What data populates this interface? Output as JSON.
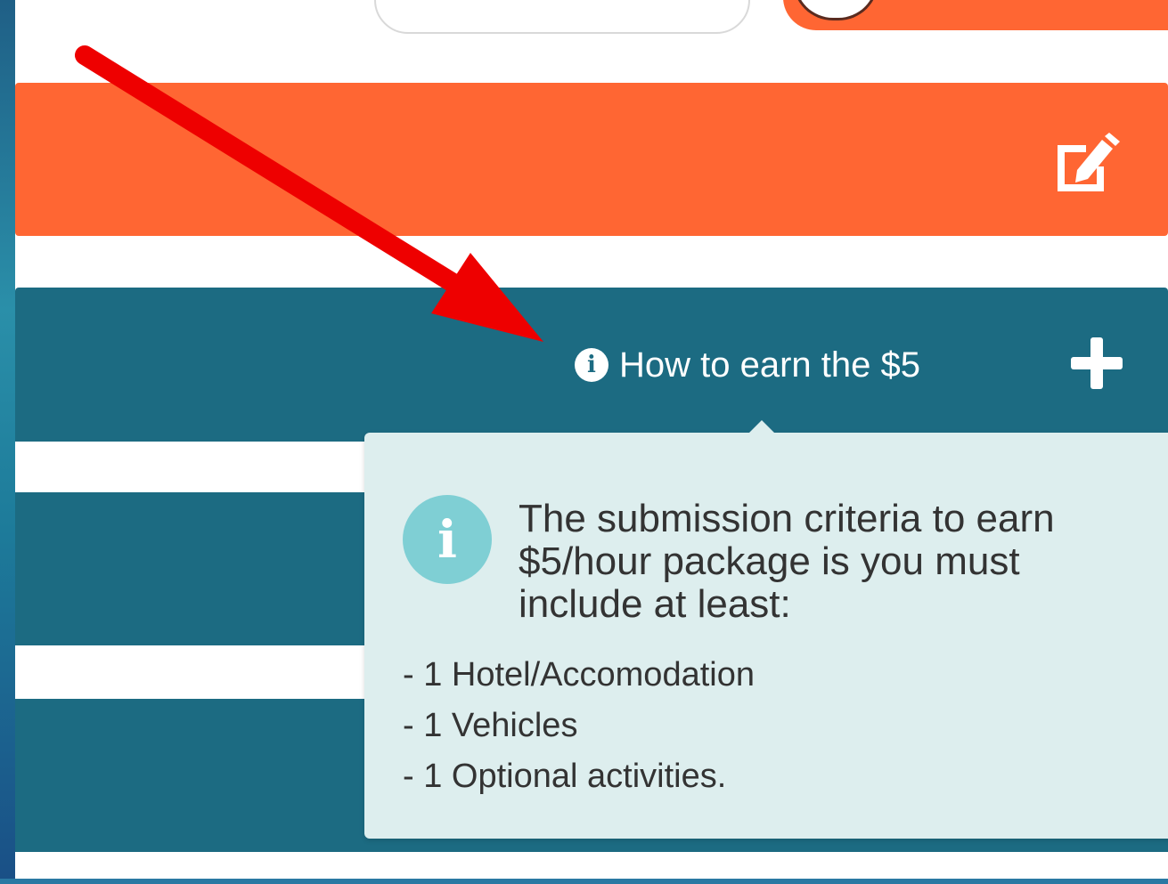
{
  "colors": {
    "orange": "#ff6633",
    "teal": "#1c6b82",
    "popover_bg": "#ddeeee",
    "info_circle": "#7fcfd4",
    "annotation_red": "#ee0000"
  },
  "orange_bar": {
    "action_icon": "edit-icon"
  },
  "earn_section": {
    "link_label": "How to earn the $5",
    "link_icon": "info-icon",
    "toggle_icon": "plus-icon"
  },
  "popover": {
    "icon": "info-icon",
    "message": "The submission criteria to earn $5/hour package is you must include at least:",
    "items": [
      "- 1 Hotel/Accomodation",
      "- 1 Vehicles",
      "- 1 Optional activities."
    ]
  }
}
